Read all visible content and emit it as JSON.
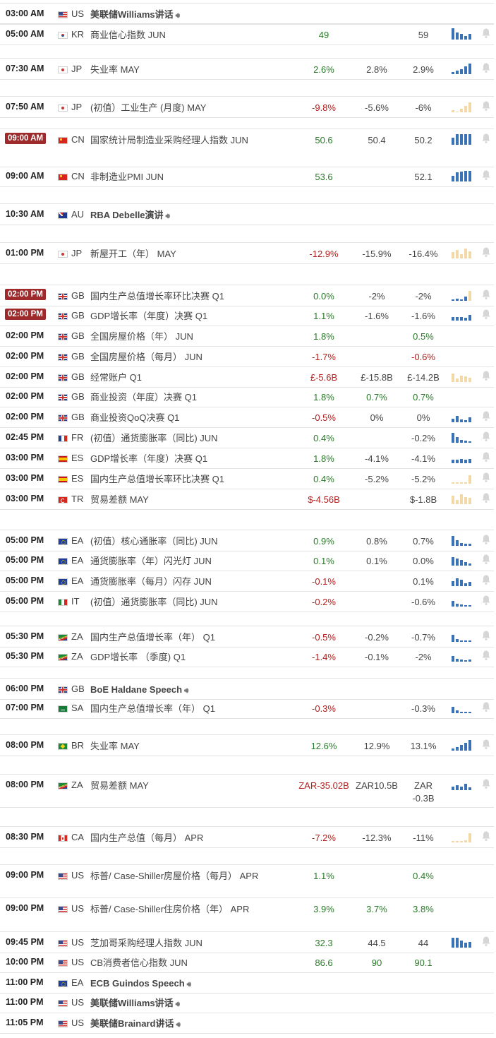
{
  "colors": {
    "positive": "#2a7a2a",
    "negative": "#b0201f",
    "badge": "#9e2a2b",
    "spark_blue": "#3a73b5",
    "spark_tan": "#f2d9a6"
  },
  "events": [
    {
      "time": "03:00 AM",
      "flag": "us",
      "country": "US",
      "name": "美联储Williams讲话",
      "speech": true,
      "bold": true,
      "spark": "none"
    },
    {
      "time": "05:00 AM",
      "flag": "kr",
      "country": "KR",
      "name": "商业信心指数 JUN",
      "actual": "49",
      "actual_cls": "pos",
      "forecast": "",
      "previous": "59",
      "spark": "blue",
      "bars": [
        16,
        10,
        8,
        5,
        8
      ]
    },
    {
      "time": "07:30 AM",
      "flag": "jp",
      "country": "JP",
      "name": "失业率 MAY",
      "actual": "2.6%",
      "actual_cls": "pos",
      "forecast": "2.8%",
      "previous": "2.9%",
      "previous_cls": "neu",
      "spark": "blue",
      "bars": [
        3,
        5,
        7,
        11,
        15
      ]
    },
    {
      "time": "07:50 AM",
      "flag": "jp",
      "country": "JP",
      "name": "(初值）工业生产 (月度) MAY",
      "actual": "-9.8%",
      "actual_cls": "neg",
      "forecast": "-5.6%",
      "previous": "-6%",
      "spark": "tan",
      "bars": [
        3,
        1,
        5,
        9,
        14
      ]
    },
    {
      "time": "09:00 AM",
      "badge": true,
      "flag": "cn",
      "country": "CN",
      "name": "国家统计局制造业采购经理人指数 JUN",
      "actual": "50.6",
      "actual_cls": "pos",
      "forecast": "50.4",
      "previous": "50.2",
      "spark": "blue",
      "bars": [
        10,
        15,
        15,
        15,
        15
      ]
    },
    {
      "time": "09:00 AM",
      "flag": "cn",
      "country": "CN",
      "name": "非制造业PMI JUN",
      "actual": "53.6",
      "actual_cls": "pos",
      "forecast": "",
      "previous": "52.1",
      "spark": "blue",
      "bars": [
        8,
        13,
        14,
        15,
        15
      ]
    },
    {
      "time": "10:30 AM",
      "flag": "au",
      "country": "AU",
      "name": "RBA Debelle演讲",
      "speech": true,
      "bold": true,
      "spark": "none"
    },
    {
      "time": "01:00 PM",
      "flag": "jp",
      "country": "JP",
      "name": "新屋开工（年） MAY",
      "actual": "-12.9%",
      "actual_cls": "neg",
      "forecast": "-15.9%",
      "previous": "-16.4%",
      "spark": "tan",
      "bars": [
        9,
        12,
        6,
        14,
        10
      ]
    },
    {
      "time": "02:00 PM",
      "badge": true,
      "flag": "gb",
      "country": "GB",
      "name": "国内生产总值增长率环比决赛 Q1",
      "actual": "0.0%",
      "actual_cls": "pos",
      "forecast": "-2%",
      "previous": "-2%",
      "spark": "mix",
      "bars": [
        2,
        3,
        2,
        6,
        14
      ]
    },
    {
      "time": "02:00 PM",
      "badge": true,
      "flag": "gb",
      "country": "GB",
      "name": "GDP增长率（年度）决赛 Q1",
      "actual": "1.1%",
      "actual_cls": "pos",
      "forecast": "-1.6%",
      "previous": "-1.6%",
      "spark": "mix",
      "bars": [
        5,
        5,
        5,
        4,
        8
      ]
    },
    {
      "time": "02:00 PM",
      "flag": "gb",
      "country": "GB",
      "name": "全国房屋价格（年） JUN",
      "actual": "1.8%",
      "actual_cls": "pos",
      "forecast": "",
      "previous": "0.5%",
      "previous_cls": "pos",
      "spark": "none"
    },
    {
      "time": "02:00 PM",
      "flag": "gb",
      "country": "GB",
      "name": "全国房屋价格（每月） JUN",
      "actual": "-1.7%",
      "actual_cls": "neg",
      "forecast": "",
      "previous": "-0.6%",
      "previous_cls": "neg",
      "spark": "none"
    },
    {
      "time": "02:00 PM",
      "flag": "gb",
      "country": "GB",
      "name": "经常账户 Q1",
      "actual": "£-5.6B",
      "actual_cls": "neg",
      "forecast": "£-15.8B",
      "previous": "£-14.2B",
      "spark": "tan",
      "bars": [
        12,
        5,
        9,
        8,
        6
      ]
    },
    {
      "time": "02:00 PM",
      "flag": "gb",
      "country": "GB",
      "name": "商业投资（年度）决赛 Q1",
      "actual": "1.8%",
      "actual_cls": "pos",
      "forecast": "0.7%",
      "forecast_cls": "pos",
      "previous": "0.7%",
      "previous_cls": "pos",
      "spark": "none"
    },
    {
      "time": "02:00 PM",
      "flag": "gb",
      "country": "GB",
      "name": "商业投资QoQ决赛 Q1",
      "actual": "-0.5%",
      "actual_cls": "neg",
      "forecast": "0%",
      "previous": "0%",
      "spark": "blue",
      "bars": [
        5,
        9,
        4,
        3,
        7
      ]
    },
    {
      "time": "02:45 PM",
      "flag": "fr",
      "country": "FR",
      "name": "(初值）通货膨胀率（同比) JUN",
      "actual": "0.4%",
      "actual_cls": "pos",
      "forecast": "",
      "previous": "-0.2%",
      "spark": "blue",
      "bars": [
        14,
        8,
        4,
        3,
        2
      ]
    },
    {
      "time": "03:00 PM",
      "flag": "es",
      "country": "ES",
      "name": "GDP增长率（年度）决赛 Q1",
      "actual": "1.8%",
      "actual_cls": "pos",
      "forecast": "-4.1%",
      "previous": "-4.1%",
      "spark": "mix",
      "bars": [
        5,
        5,
        6,
        5,
        6
      ]
    },
    {
      "time": "03:00 PM",
      "flag": "es",
      "country": "ES",
      "name": "国内生产总值增长率环比决赛 Q1",
      "actual": "0.4%",
      "actual_cls": "pos",
      "forecast": "-5.2%",
      "previous": "-5.2%",
      "spark": "tan",
      "bars": [
        2,
        2,
        2,
        2,
        12
      ]
    },
    {
      "time": "03:00 PM",
      "flag": "tr",
      "country": "TR",
      "name": "贸易差额 MAY",
      "actual": "$-4.56B",
      "actual_cls": "neg",
      "forecast": "",
      "previous": "$-1.8B",
      "spark": "tan",
      "bars": [
        12,
        6,
        14,
        10,
        9
      ]
    },
    {
      "time": "05:00 PM",
      "flag": "ea",
      "country": "EA",
      "name": "(初值）核心通胀率（同比) JUN",
      "actual": "0.9%",
      "actual_cls": "pos",
      "forecast": "0.8%",
      "previous": "0.7%",
      "spark": "blue",
      "bars": [
        14,
        8,
        4,
        3,
        3
      ]
    },
    {
      "time": "05:00 PM",
      "flag": "ea",
      "country": "EA",
      "name": "通货膨胀率（年）闪光灯 JUN",
      "actual": "0.1%",
      "actual_cls": "pos",
      "forecast": "0.1%",
      "previous": "0.0%",
      "spark": "blue",
      "bars": [
        12,
        10,
        8,
        5,
        3
      ]
    },
    {
      "time": "05:00 PM",
      "flag": "ea",
      "country": "EA",
      "name": "通货膨胀率（每月）闪存 JUN",
      "actual": "-0.1%",
      "actual_cls": "neg",
      "forecast": "",
      "previous": "0.1%",
      "spark": "blue",
      "bars": [
        7,
        11,
        9,
        4,
        6
      ]
    },
    {
      "time": "05:00 PM",
      "flag": "it",
      "country": "IT",
      "name": "(初值）通货膨胀率（同比) JUN",
      "actual": "-0.2%",
      "actual_cls": "neg",
      "forecast": "",
      "previous": "-0.6%",
      "spark": "blue",
      "bars": [
        8,
        4,
        3,
        2,
        2
      ]
    },
    {
      "time": "05:30 PM",
      "flag": "za",
      "country": "ZA",
      "name": "国内生产总值增长率（年） Q1",
      "actual": "-0.5%",
      "actual_cls": "neg",
      "forecast": "-0.2%",
      "previous": "-0.7%",
      "spark": "mix",
      "bars": [
        10,
        4,
        2,
        2,
        2
      ]
    },
    {
      "time": "05:30 PM",
      "flag": "za",
      "country": "ZA",
      "name": "GDP增长率 （季度) Q1",
      "actual": "-1.4%",
      "actual_cls": "neg",
      "forecast": "-0.1%",
      "previous": "-2%",
      "spark": "mix",
      "bars": [
        8,
        4,
        3,
        2,
        3
      ]
    },
    {
      "time": "06:00 PM",
      "flag": "gb",
      "country": "GB",
      "name": "BoE Haldane Speech",
      "speech": true,
      "bold": true,
      "spark": "none"
    },
    {
      "time": "07:00 PM",
      "flag": "sa",
      "country": "SA",
      "name": "国内生产总值增长率（年） Q1",
      "actual": "-0.3%",
      "actual_cls": "neg",
      "forecast": "",
      "previous": "-0.3%",
      "spark": "blue",
      "bars": [
        9,
        4,
        2,
        2,
        2
      ]
    },
    {
      "time": "08:00 PM",
      "flag": "br",
      "country": "BR",
      "name": "失业率 MAY",
      "actual": "12.6%",
      "actual_cls": "pos",
      "forecast": "12.9%",
      "previous": "13.1%",
      "spark": "blue",
      "bars": [
        3,
        5,
        8,
        11,
        15
      ]
    },
    {
      "time": "08:00 PM",
      "flag": "za",
      "country": "ZA",
      "name": "贸易差额 MAY",
      "actual": "ZAR-35.02B",
      "actual_cls": "neg",
      "forecast": "ZAR10.5B",
      "previous": "ZAR -0.3B",
      "spark": "mix",
      "bars": [
        5,
        7,
        5,
        9,
        4
      ]
    },
    {
      "time": "08:30 PM",
      "flag": "ca",
      "country": "CA",
      "name": "国内生产总值（每月） APR",
      "actual": "-7.2%",
      "actual_cls": "neg",
      "forecast": "-12.3%",
      "previous": "-11%",
      "spark": "tan",
      "bars": [
        2,
        2,
        2,
        3,
        13
      ]
    },
    {
      "time": "09:00 PM",
      "flag": "us",
      "country": "US",
      "name": "标普/ Case-Shiller房屋价格（每月） APR",
      "actual": "1.1%",
      "actual_cls": "pos",
      "forecast": "",
      "previous": "0.4%",
      "previous_cls": "pos",
      "spark": "none"
    },
    {
      "time": "09:00 PM",
      "flag": "us",
      "country": "US",
      "name": "标普/ Case-Shiller住房价格（年） APR",
      "actual": "3.9%",
      "actual_cls": "pos",
      "forecast": "3.7%",
      "forecast_cls": "pos",
      "previous": "3.8%",
      "previous_cls": "pos",
      "spark": "none"
    },
    {
      "time": "09:45 PM",
      "flag": "us",
      "country": "US",
      "name": "芝加哥采购经理人指数 JUN",
      "actual": "32.3",
      "actual_cls": "pos",
      "forecast": "44.5",
      "previous": "44",
      "spark": "blue",
      "bars": [
        14,
        14,
        10,
        7,
        8
      ]
    },
    {
      "time": "10:00 PM",
      "flag": "us",
      "country": "US",
      "name": "CB消费者信心指数 JUN",
      "actual": "86.6",
      "actual_cls": "pos",
      "forecast": "90",
      "forecast_cls": "pos",
      "previous": "90.1",
      "previous_cls": "pos",
      "spark": "none"
    },
    {
      "time": "11:00 PM",
      "flag": "ea",
      "country": "EA",
      "name": "ECB Guindos Speech",
      "speech": true,
      "bold": true,
      "spark": "none"
    },
    {
      "time": "11:00 PM",
      "flag": "us",
      "country": "US",
      "name": "美联储Williams讲话",
      "speech": true,
      "bold": true,
      "spark": "none"
    },
    {
      "time": "11:05 PM",
      "flag": "us",
      "country": "US",
      "name": "美联储Brainard讲话",
      "speech": true,
      "bold": true,
      "spark": "none"
    }
  ]
}
